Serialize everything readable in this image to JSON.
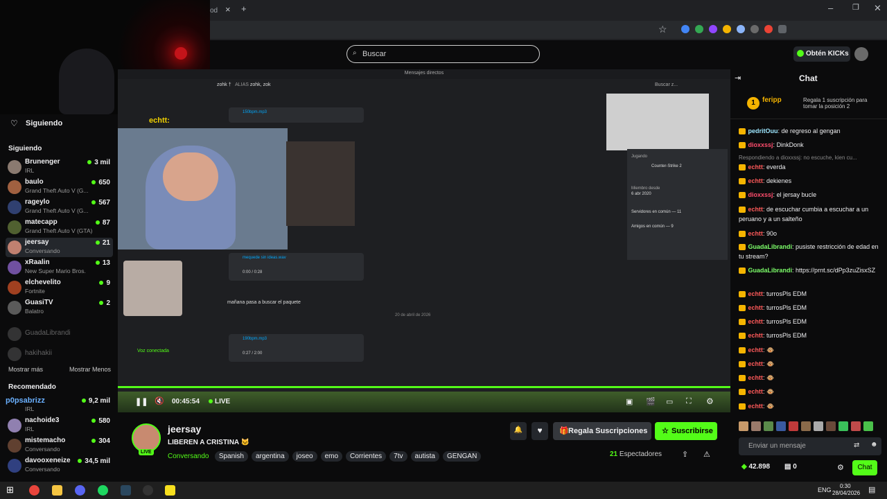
{
  "browser": {
    "tab_text": "od",
    "close": "×",
    "new_tab": "+"
  },
  "kick": {
    "search_placeholder": "Buscar",
    "get_kicks": "Obtén KICKs",
    "sidebar": {
      "following_title": "Siguiendo",
      "following_section": "Siguiendo",
      "channels": [
        {
          "name": "Brunenger",
          "game": "IRL",
          "count": "3 mil",
          "color": "#8a7a70"
        },
        {
          "name": "baulo",
          "game": "Grand Theft Auto V (G...",
          "count": "650",
          "color": "#a06040"
        },
        {
          "name": "rageylo",
          "game": "Grand Theft Auto V (G...",
          "count": "567",
          "color": "#304070"
        },
        {
          "name": "matecapp",
          "game": "Grand Theft Auto V (GTA)",
          "count": "87",
          "color": "#506030"
        },
        {
          "name": "jeersay",
          "game": "Conversando",
          "count": "21",
          "color": "#c08070"
        },
        {
          "name": "xRaalin",
          "game": "New Super Mario Bros.",
          "count": "13",
          "color": "#7050a0"
        },
        {
          "name": "elchevelito",
          "game": "Fortnite",
          "count": "9",
          "color": "#a04020"
        },
        {
          "name": "GuasiTV",
          "game": "Balatro",
          "count": "2",
          "color": "#5a5a5a"
        }
      ],
      "offline": [
        "GuadaLibrandi",
        "hakihakii"
      ],
      "show_more": "Mostrar más",
      "show_less": "Mostrar Menos",
      "recommended_title": "Recomendado",
      "recommended": [
        {
          "name": "nachoide3",
          "game": "IRL",
          "count": "580",
          "color": "#9080b0"
        },
        {
          "name": "mistemacho",
          "game": "Conversando",
          "count": "304",
          "color": "#604030"
        },
        {
          "name": "davooxeneize",
          "game": "Conversando",
          "count": "34,5 mil",
          "color": "#304080"
        }
      ],
      "rec_top_count": "9,2 mil",
      "rec_top_game": "IRL",
      "overlay_name": "p0psabrizz"
    },
    "video": {
      "time": "00:45:54",
      "live": "LIVE",
      "discord_title": "Mensajes directos",
      "discord_user": "zohk †",
      "discord_alias": "ALIAS",
      "discord_alias_val": "zohk, zok",
      "discord_msg1": "mañana pasa a buscar el paquete",
      "discord_file1": "150bpm.mp3",
      "discord_file2": "mequede sin ideas.wav",
      "discord_file3": "190bpm.mp3",
      "discord_date": "20 de abril de 2026",
      "discord_game": "Counter-Strike 2",
      "discord_game_label": "Jugando",
      "discord_member_since_label": "Miembro desde",
      "discord_member_since": "6 abr 2020",
      "discord_servers": "Servidores en común — 11",
      "discord_friends": "Amigos en común — 9",
      "discord_search": "Buscar z...",
      "discord_voice": "Voz conectada",
      "overlay_name": "echtt:",
      "time1": "0:00 / 0:28",
      "time2": "0:27 / 2:00"
    },
    "stream": {
      "username": "jeersay",
      "title": "LIBEREN A CRISTINA 🐱",
      "category": "Conversando",
      "tags": [
        "Spanish",
        "argentina",
        "joseo",
        "emo",
        "Corrientes",
        "7tv",
        "autista",
        "GENGAN"
      ],
      "viewers": "21",
      "viewers_label": "Espectadores",
      "gift_label": "Regala Suscripciones",
      "subscribe_label": "Suscribirse",
      "live_badge": "LIVE"
    },
    "chat": {
      "title": "Chat",
      "pinned_user": "feripp",
      "pinned_text": "Regala 1 suscripción para tomar la posición 2",
      "pinned_rank": "1",
      "messages": [
        {
          "user": "pedritOuu",
          "text": "de regreso al gengan",
          "color": "#9ee7ff"
        },
        {
          "user": "dioxxssj",
          "text": "DinkDonk",
          "color": "#ff4d6d"
        },
        {
          "user": "",
          "text": "Respondiendo a dioxxssj: no escuche, kien cu...",
          "color": "#8a8a8a",
          "reply": true
        },
        {
          "user": "echtt",
          "text": "everda",
          "color": "#ff5a5a"
        },
        {
          "user": "echtt",
          "text": "dekienes",
          "color": "#ff5a5a"
        },
        {
          "user": "dioxxssj",
          "text": "el jersay bucle",
          "color": "#ff4d6d"
        },
        {
          "user": "echtt",
          "text": "de escuchar cumbia a escuchar a un peruano y a un salteño",
          "color": "#ff5a5a"
        },
        {
          "user": "echtt",
          "text": "90o",
          "color": "#ff5a5a"
        },
        {
          "user": "GuadaLibrandi",
          "text": "pusiste restricción de edad en tu stream?",
          "color": "#7dff6a"
        },
        {
          "user": "GuadaLibrandi",
          "text": "https://prnt.sc/dPp3zuZisxSZ",
          "color": "#7dff6a"
        },
        {
          "user": "echtt",
          "text": "turrosPls EDM",
          "color": "#ff5a5a"
        },
        {
          "user": "echtt",
          "text": "turrosPls EDM",
          "color": "#ff5a5a"
        },
        {
          "user": "echtt",
          "text": "turrosPls EDM",
          "color": "#ff5a5a"
        },
        {
          "user": "echtt",
          "text": "turrosPls EDM",
          "color": "#ff5a5a"
        },
        {
          "user": "echtt",
          "text": "🐵",
          "color": "#ff5a5a"
        },
        {
          "user": "echtt",
          "text": "🐵",
          "color": "#ff5a5a"
        },
        {
          "user": "echtt",
          "text": "🐵",
          "color": "#ff5a5a"
        },
        {
          "user": "echtt",
          "text": "🐵",
          "color": "#ff5a5a"
        },
        {
          "user": "echtt",
          "text": "🐵",
          "color": "#ff5a5a"
        }
      ],
      "input_placeholder": "Enviar un mensaje",
      "points": "42.898",
      "gifts": "0",
      "send_label": "Chat"
    }
  },
  "taskbar": {
    "lang": "ENG",
    "time": "0:30",
    "date": "28/04/2026"
  },
  "colors": {
    "accent": "#53fc18",
    "bg": "#0b0b0c",
    "panel": "#24272c"
  }
}
